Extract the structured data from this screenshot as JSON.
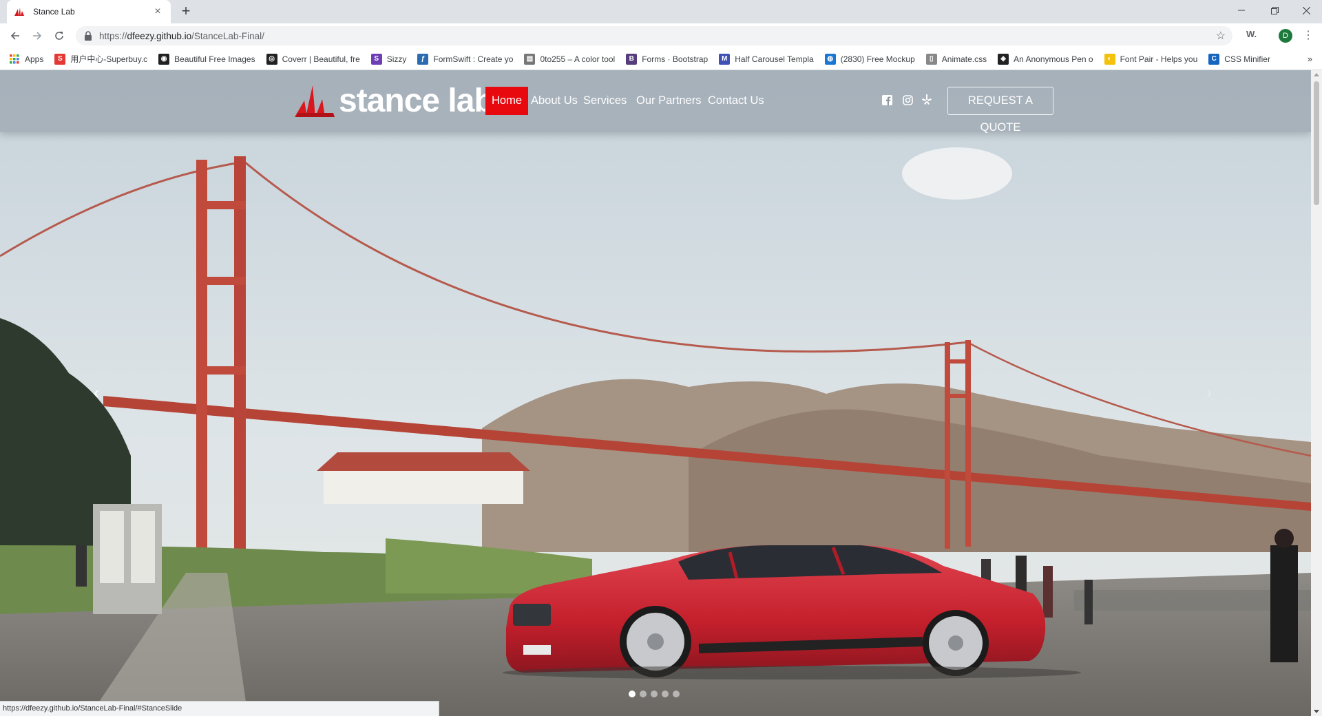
{
  "browser": {
    "tab_title": "Stance Lab",
    "tab_close": "×",
    "new_tab": "+",
    "url_prefix": "https://",
    "url_host": "dfeezy.github.io",
    "url_path": "/StanceLab-Final/",
    "ext_label": "W.",
    "profile_initial": "D",
    "status_url": "https://dfeezy.github.io/StanceLab-Final/#StanceSlide"
  },
  "bookmarks": [
    {
      "label": "Apps",
      "icon": "apps-grid-icon",
      "color": "#ea4335"
    },
    {
      "label": "用户中心-Superbuy.c",
      "icon": "superbuy-icon",
      "color": "#e53935"
    },
    {
      "label": "Beautiful Free Images",
      "icon": "camera-icon",
      "color": "#222222"
    },
    {
      "label": "Coverr | Beautiful, fre",
      "icon": "coverr-icon",
      "color": "#222222"
    },
    {
      "label": "Sizzy",
      "icon": "sizzy-icon",
      "color": "#6c3fb5"
    },
    {
      "label": "FormSwift : Create yo",
      "icon": "formswift-icon",
      "color": "#2b6cb0"
    },
    {
      "label": "0to255 – A color tool",
      "icon": "0to255-icon",
      "color": "#777777"
    },
    {
      "label": "Forms · Bootstrap",
      "icon": "bootstrap-icon",
      "color": "#563d7c"
    },
    {
      "label": "Half Carousel Templa",
      "icon": "mdb-icon",
      "color": "#3f51b5"
    },
    {
      "label": "(2830) Free Mockup",
      "icon": "mockup-icon",
      "color": "#1976d2"
    },
    {
      "label": "Animate.css",
      "icon": "page-icon",
      "color": "#888888"
    },
    {
      "label": "An Anonymous Pen o",
      "icon": "codepen-icon",
      "color": "#222222"
    },
    {
      "label": "Font Pair - Helps you",
      "icon": "fontpair-icon",
      "color": "#f4c20d"
    },
    {
      "label": "CSS Minifier",
      "icon": "css-icon",
      "color": "#1565c0"
    }
  ],
  "bookmarks_more": "»",
  "navbar": {
    "brand": "stance lab",
    "links": [
      "Home",
      "About Us",
      "Services",
      "Our Partners",
      "Contact Us"
    ],
    "active_link": "Home",
    "quote_button": "REQUEST A QUOTE",
    "social_icons": [
      "facebook-icon",
      "instagram-icon",
      "yelp-icon"
    ]
  },
  "carousel": {
    "prev": "‹",
    "next": "›",
    "slide_count": 5,
    "active_slide": 1
  },
  "colors": {
    "accent": "#e8090f",
    "car": "#c8202b",
    "bridge": "#c0463a",
    "sky": "#dfe6ea"
  }
}
